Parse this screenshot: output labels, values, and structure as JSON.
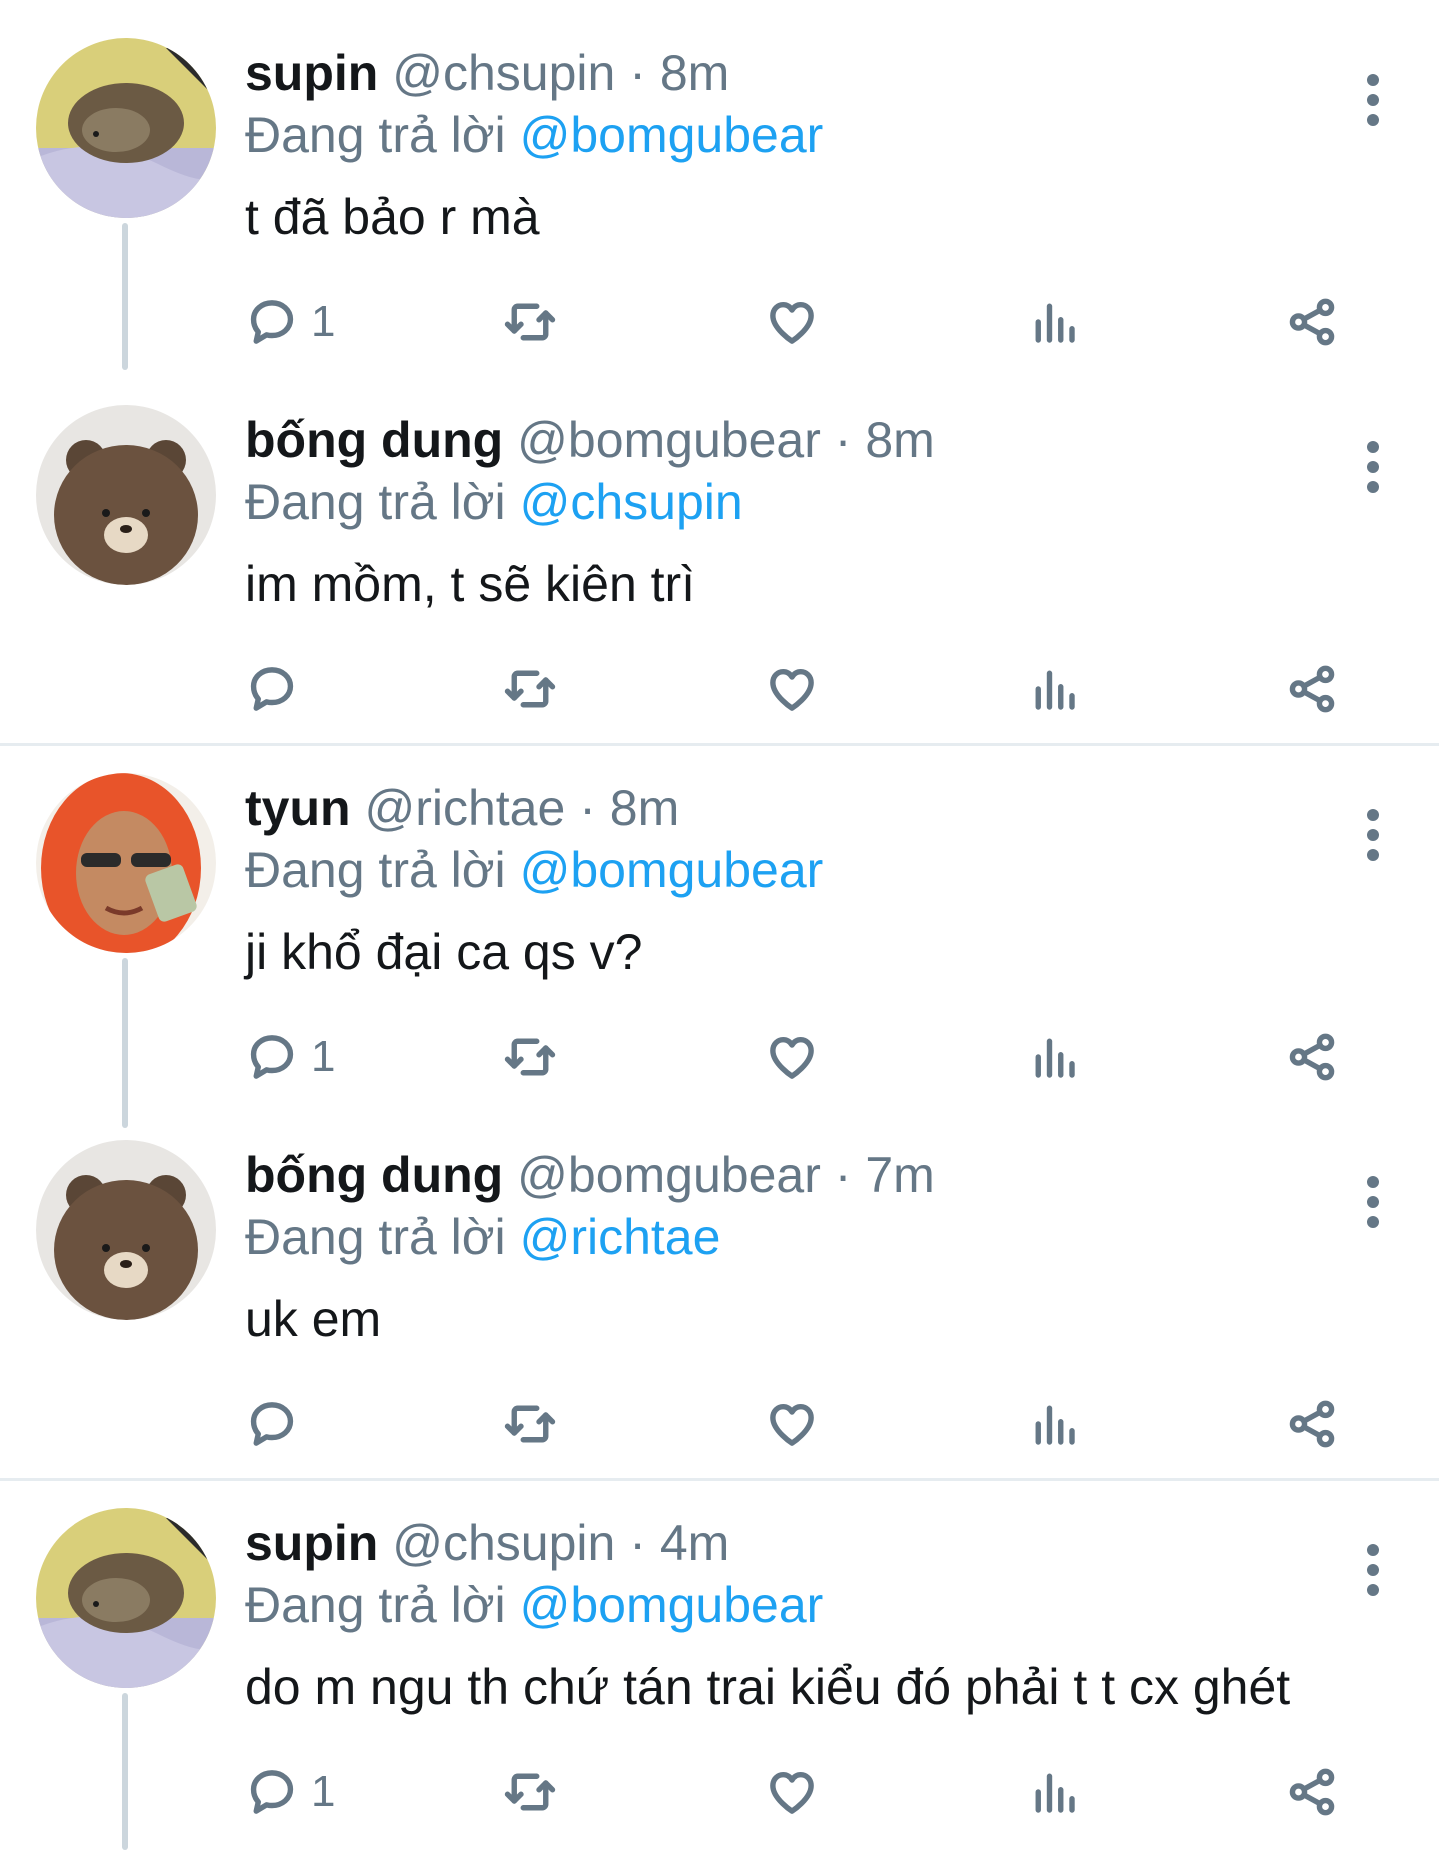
{
  "reply_prefix": "Đang trả lời",
  "tweets": [
    {
      "name": "supin",
      "handle": "@chsupin",
      "separator": "·",
      "time": "8m",
      "reply_to": "@bomgubear",
      "text": "t đã bảo r mà",
      "reply_count": "1",
      "avatar": "hedgehog-avatar"
    },
    {
      "name": "bống dung",
      "handle": "@bomgubear",
      "separator": "·",
      "time": "8m",
      "reply_to": "@chsupin",
      "text": "im mồm, t sẽ kiên trì",
      "reply_count": "",
      "avatar": "bear-avatar"
    },
    {
      "name": "tyun",
      "handle": "@richtae",
      "separator": "·",
      "time": "8m",
      "reply_to": "@bomgubear",
      "text": "ji khổ đại ca qs v?",
      "reply_count": "1",
      "avatar": "orange-hair-avatar"
    },
    {
      "name": "bống dung",
      "handle": "@bomgubear",
      "separator": "·",
      "time": "7m",
      "reply_to": "@richtae",
      "text": "uk em",
      "reply_count": "",
      "avatar": "bear-avatar"
    },
    {
      "name": "supin",
      "handle": "@chsupin",
      "separator": "·",
      "time": "4m",
      "reply_to": "@bomgubear",
      "text": "do m ngu th chứ tán trai kiểu đó phải t t cx ghét",
      "reply_count": "1",
      "avatar": "hedgehog-avatar"
    }
  ],
  "colors": {
    "link": "#1da1f2",
    "secondary": "#657786",
    "primary_text": "#14171a",
    "divider": "#e6ecf0",
    "thread_line": "#ccd6dd"
  },
  "icons": [
    "reply-icon",
    "retweet-icon",
    "like-icon",
    "stats-icon",
    "share-icon",
    "more-options-icon"
  ]
}
